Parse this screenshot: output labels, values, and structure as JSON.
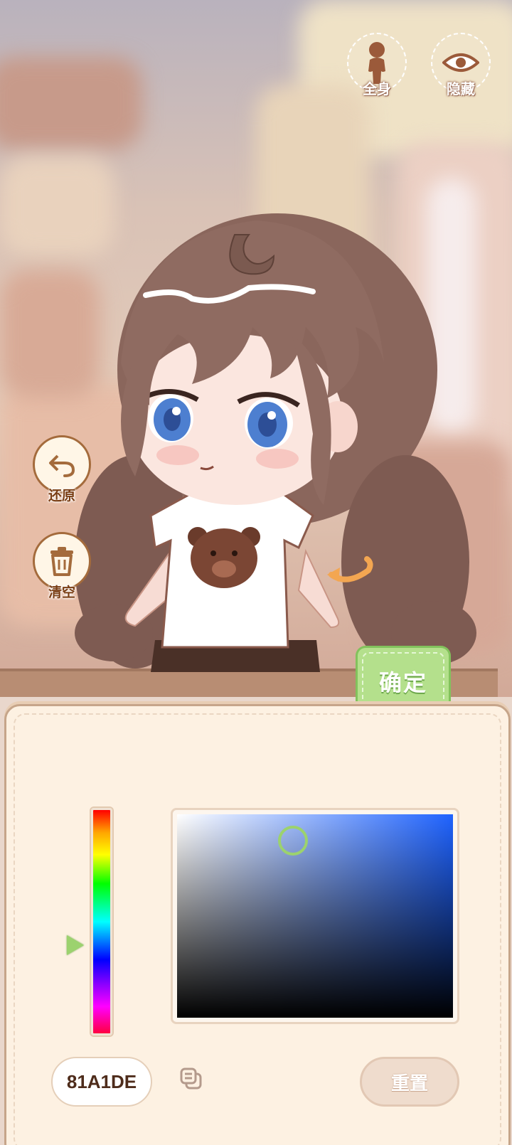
{
  "top_buttons": {
    "fullbody_label": "全身",
    "hide_label": "隐藏"
  },
  "tools": {
    "restore_label": "还原",
    "clear_label": "清空"
  },
  "confirm_label": "确定",
  "color_picker": {
    "hex_value": "81A1DE",
    "reset_label": "重置",
    "selected_color": "#81a1de",
    "hue_color": "#1f63ff"
  },
  "colors": {
    "confirm_green": "#b4e08c",
    "panel_bg": "#fdf1e2",
    "tool_border": "#a46b3c"
  }
}
